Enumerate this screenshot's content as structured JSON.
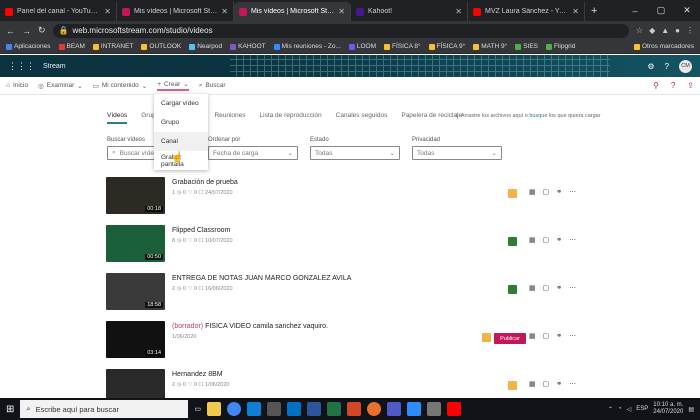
{
  "tabs": [
    {
      "title": "Panel del canal - YouTube Studio",
      "color": "#ff0000",
      "active": false
    },
    {
      "title": "Mis vídeos | Microsoft Stream",
      "color": "#c2185b",
      "active": false
    },
    {
      "title": "Mis vídeos | Microsoft Stream",
      "color": "#c2185b",
      "active": true
    },
    {
      "title": "Kahoot!",
      "color": "#46178f",
      "active": false
    },
    {
      "title": "MVZ Laura Sánchez - YouTube",
      "color": "#ff0000",
      "active": false
    }
  ],
  "address": {
    "url": "web.microsoftstream.com/studio/videos"
  },
  "bookmarks": [
    {
      "label": "Aplicaciones",
      "color": "#4285f4"
    },
    {
      "label": "BEAM",
      "color": "#e53935"
    },
    {
      "label": "INTRANET",
      "color": "#fbc02d"
    },
    {
      "label": "OUTLOOK",
      "color": "#fbc02d"
    },
    {
      "label": "Nearpod",
      "color": "#4fc3f7"
    },
    {
      "label": "KAHOOT",
      "color": "#7e57c2"
    },
    {
      "label": "Mis reuniones - Zo...",
      "color": "#2d8cff"
    },
    {
      "label": "LOOM",
      "color": "#625df5"
    },
    {
      "label": "FÍSICA 8°",
      "color": "#fbc02d"
    },
    {
      "label": "FÍSICA 9°",
      "color": "#fbc02d"
    },
    {
      "label": "MATH 9°",
      "color": "#fbc02d"
    },
    {
      "label": "SIES",
      "color": "#4caf50"
    },
    {
      "label": "Flipgrid",
      "color": "#4caf50"
    }
  ],
  "bookmarks_right": "Otros marcadores",
  "stream": {
    "app_name": "Stream",
    "avatar": "CM"
  },
  "command_bar": {
    "items": [
      "Inicio",
      "Examinar",
      "Mi contenido",
      "Crear"
    ],
    "search_placeholder": "Buscar"
  },
  "subtabs": [
    "Vídeos",
    "Grupos",
    "Canales",
    "Reuniones",
    "Lista de reproducción",
    "Canales seguidos",
    "Papelera de reciclaje"
  ],
  "hint": {
    "text": "Arrastre los archivos aquí o",
    "link": "busque",
    "rest": "los que quiera cargar"
  },
  "filters": {
    "search_label": "Buscar vídeos",
    "search_placeholder": "Buscar vídeos",
    "order_label": "Ordenar por",
    "order_value": "Fecha de carga",
    "status_label": "Estado",
    "status_value": "Todas",
    "privacy_label": "Privacidad",
    "privacy_value": "Todas"
  },
  "menu": [
    "Cargar vídeo",
    "Grupo",
    "Canal",
    "Grabar pantalla"
  ],
  "videos": [
    {
      "title": "Grabación de prueba",
      "draft": "",
      "meta": "1 ◷ 0 ♡ 0 ☐ 24/07/2020",
      "duration": "00:18",
      "badge": "#f3b24a",
      "published": false
    },
    {
      "title": "Flipped Classroom",
      "draft": "",
      "meta": "8 ◷ 0 ♡ 0 ☐ 10/07/2020",
      "duration": "00:50",
      "badge": "#2e7d32",
      "published": false
    },
    {
      "title": "ENTREGA DE NOTAS JUAN MARCO GONZALEZ AVILA",
      "draft": "",
      "meta": "2 ◷ 0 ♡ 0 ☐ 16/06/2020",
      "duration": "18:58",
      "badge": "#2e7d32",
      "published": false
    },
    {
      "title": "FISICA VIDEO camila sanchez vaquiro.",
      "draft": "(borrador)",
      "meta": "1/06/2020",
      "duration": "03:14",
      "badge": "#f3b24a",
      "published": true
    },
    {
      "title": "Hernandez 8BM",
      "draft": "",
      "meta": "2 ◷ 0 ♡ 0 ☐ 1/06/2020",
      "duration": "",
      "badge": "#f3b24a",
      "published": false
    }
  ],
  "publish_label": "Publicar",
  "taskbar": {
    "search_placeholder": "Escribe aquí para buscar",
    "lang": "ESP",
    "time": "10:10 a. m.",
    "date": "24/07/2020"
  }
}
